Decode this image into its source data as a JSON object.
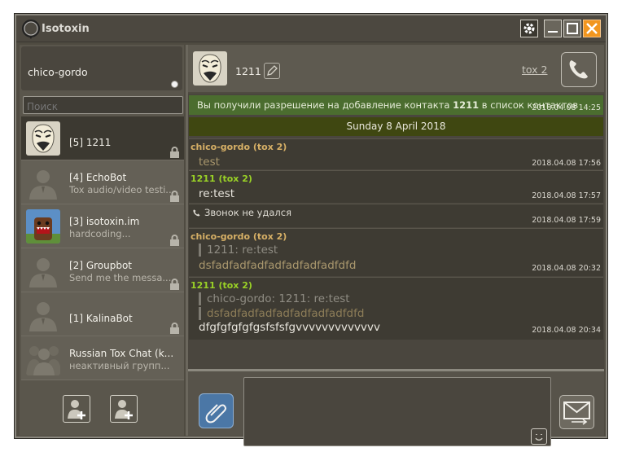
{
  "app": {
    "title": "Isotoxin"
  },
  "profile": {
    "name": "chico-gordo",
    "status": "online"
  },
  "search": {
    "placeholder": "Поиск"
  },
  "contacts": [
    {
      "name": "[5] 1211",
      "status": "",
      "avatar": "guy-fawkes-mask",
      "selected": true,
      "locked": true
    },
    {
      "name": "[4] EchoBot",
      "status": "Tox audio/video testi...",
      "avatar": "default-user",
      "selected": false,
      "locked": true
    },
    {
      "name": "[3] isotoxin.im",
      "status": "hardcoding...",
      "avatar": "domo-kun",
      "selected": false,
      "locked": true
    },
    {
      "name": "[2] Groupbot",
      "status": "Send me the messa...",
      "avatar": "default-user",
      "selected": false,
      "locked": true
    },
    {
      "name": "[1] KalinaBot",
      "status": "",
      "avatar": "default-user",
      "selected": false,
      "locked": true
    },
    {
      "name": "Russian Tox Chat (k...",
      "status": "неактивный групп...",
      "avatar": "group",
      "selected": false,
      "locked": false
    }
  ],
  "chat": {
    "contact_name": "1211",
    "protocol_link": "tox 2",
    "notice": {
      "prefix": "Вы получили разрешение на добавление контакта ",
      "bold": "1211",
      "suffix": " в список контактов",
      "time": "2018.04.08 14:25"
    },
    "date_separator": "Sunday 8 April 2018",
    "messages": [
      {
        "author": "chico-gordo (tox 2)",
        "side": "me",
        "text": "test",
        "time": "2018.04.08 17:56"
      },
      {
        "author": "1211 (tox 2)",
        "side": "them",
        "text": "re:test",
        "time": "2018.04.08 17:57"
      },
      {
        "call": "Звонок не удался",
        "time": "2018.04.08 17:59"
      },
      {
        "author": "chico-gordo (tox 2)",
        "side": "me",
        "quote": "1211: re:test",
        "text": "dsfadfadfadfadfadfadfadfdfd",
        "time": "2018.04.08 20:32"
      },
      {
        "author": "1211 (tox 2)",
        "side": "them",
        "quote": "chico-gordo: 1211: re:test",
        "quote2": "dsfadfadfadfadfadfadfadfdfd",
        "text": "dfgfgfgfgfgsfsfsfgvvvvvvvvvvvvv",
        "time": "2018.04.08 20:34"
      }
    ]
  },
  "colors": {
    "accent_close": "#f2961e",
    "notice_bg": "#4b6d2f",
    "me_author": "#d7b066",
    "them_author": "#9ad226"
  },
  "icons": [
    "settings-gear-icon",
    "minimize-icon",
    "maximize-icon",
    "close-icon",
    "lock-icon",
    "add-contact-icon",
    "add-group-icon",
    "edit-pencil-icon",
    "phone-icon",
    "paperclip-icon",
    "emoji-icon",
    "send-envelope-icon"
  ]
}
